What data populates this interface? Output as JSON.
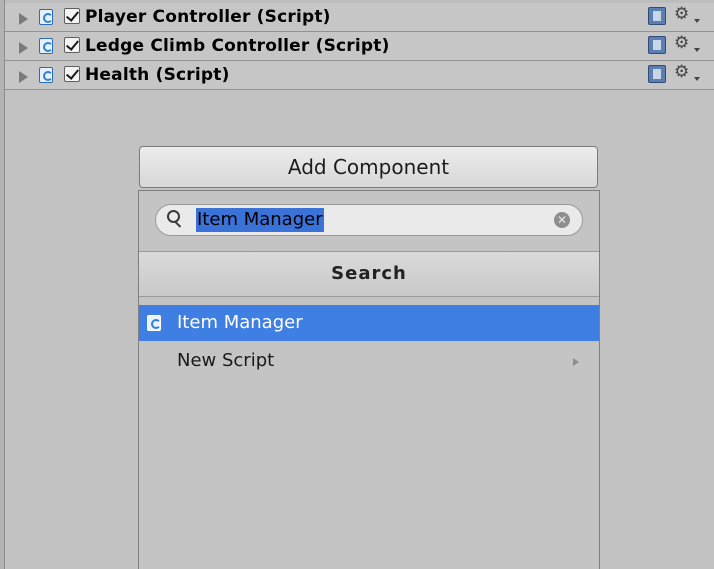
{
  "components": [
    {
      "title": "Player Controller (Script)",
      "enabled": true
    },
    {
      "title": "Ledge Climb Controller (Script)",
      "enabled": true
    },
    {
      "title": "Health (Script)",
      "enabled": true
    }
  ],
  "add_component_button": "Add Component",
  "popup": {
    "search_value": "Item Manager",
    "header": "Search",
    "results": [
      {
        "label": "Item Manager",
        "selected": true,
        "icon": "csharp-script-icon"
      },
      {
        "label": "New Script",
        "selected": false,
        "has_submenu": true
      }
    ]
  },
  "icons": {
    "foldout": "foldout-arrow-icon",
    "script": "csharp-script-icon",
    "checkbox": "checkbox-checked-icon",
    "help": "help-book-icon",
    "settings": "gear-icon",
    "search": "search-icon",
    "clear": "clear-icon",
    "submenu": "chevron-right-icon"
  },
  "colors": {
    "selection": "#3f7fe3",
    "text_highlight": "#3b72d8",
    "background": "#c2c2c2"
  }
}
